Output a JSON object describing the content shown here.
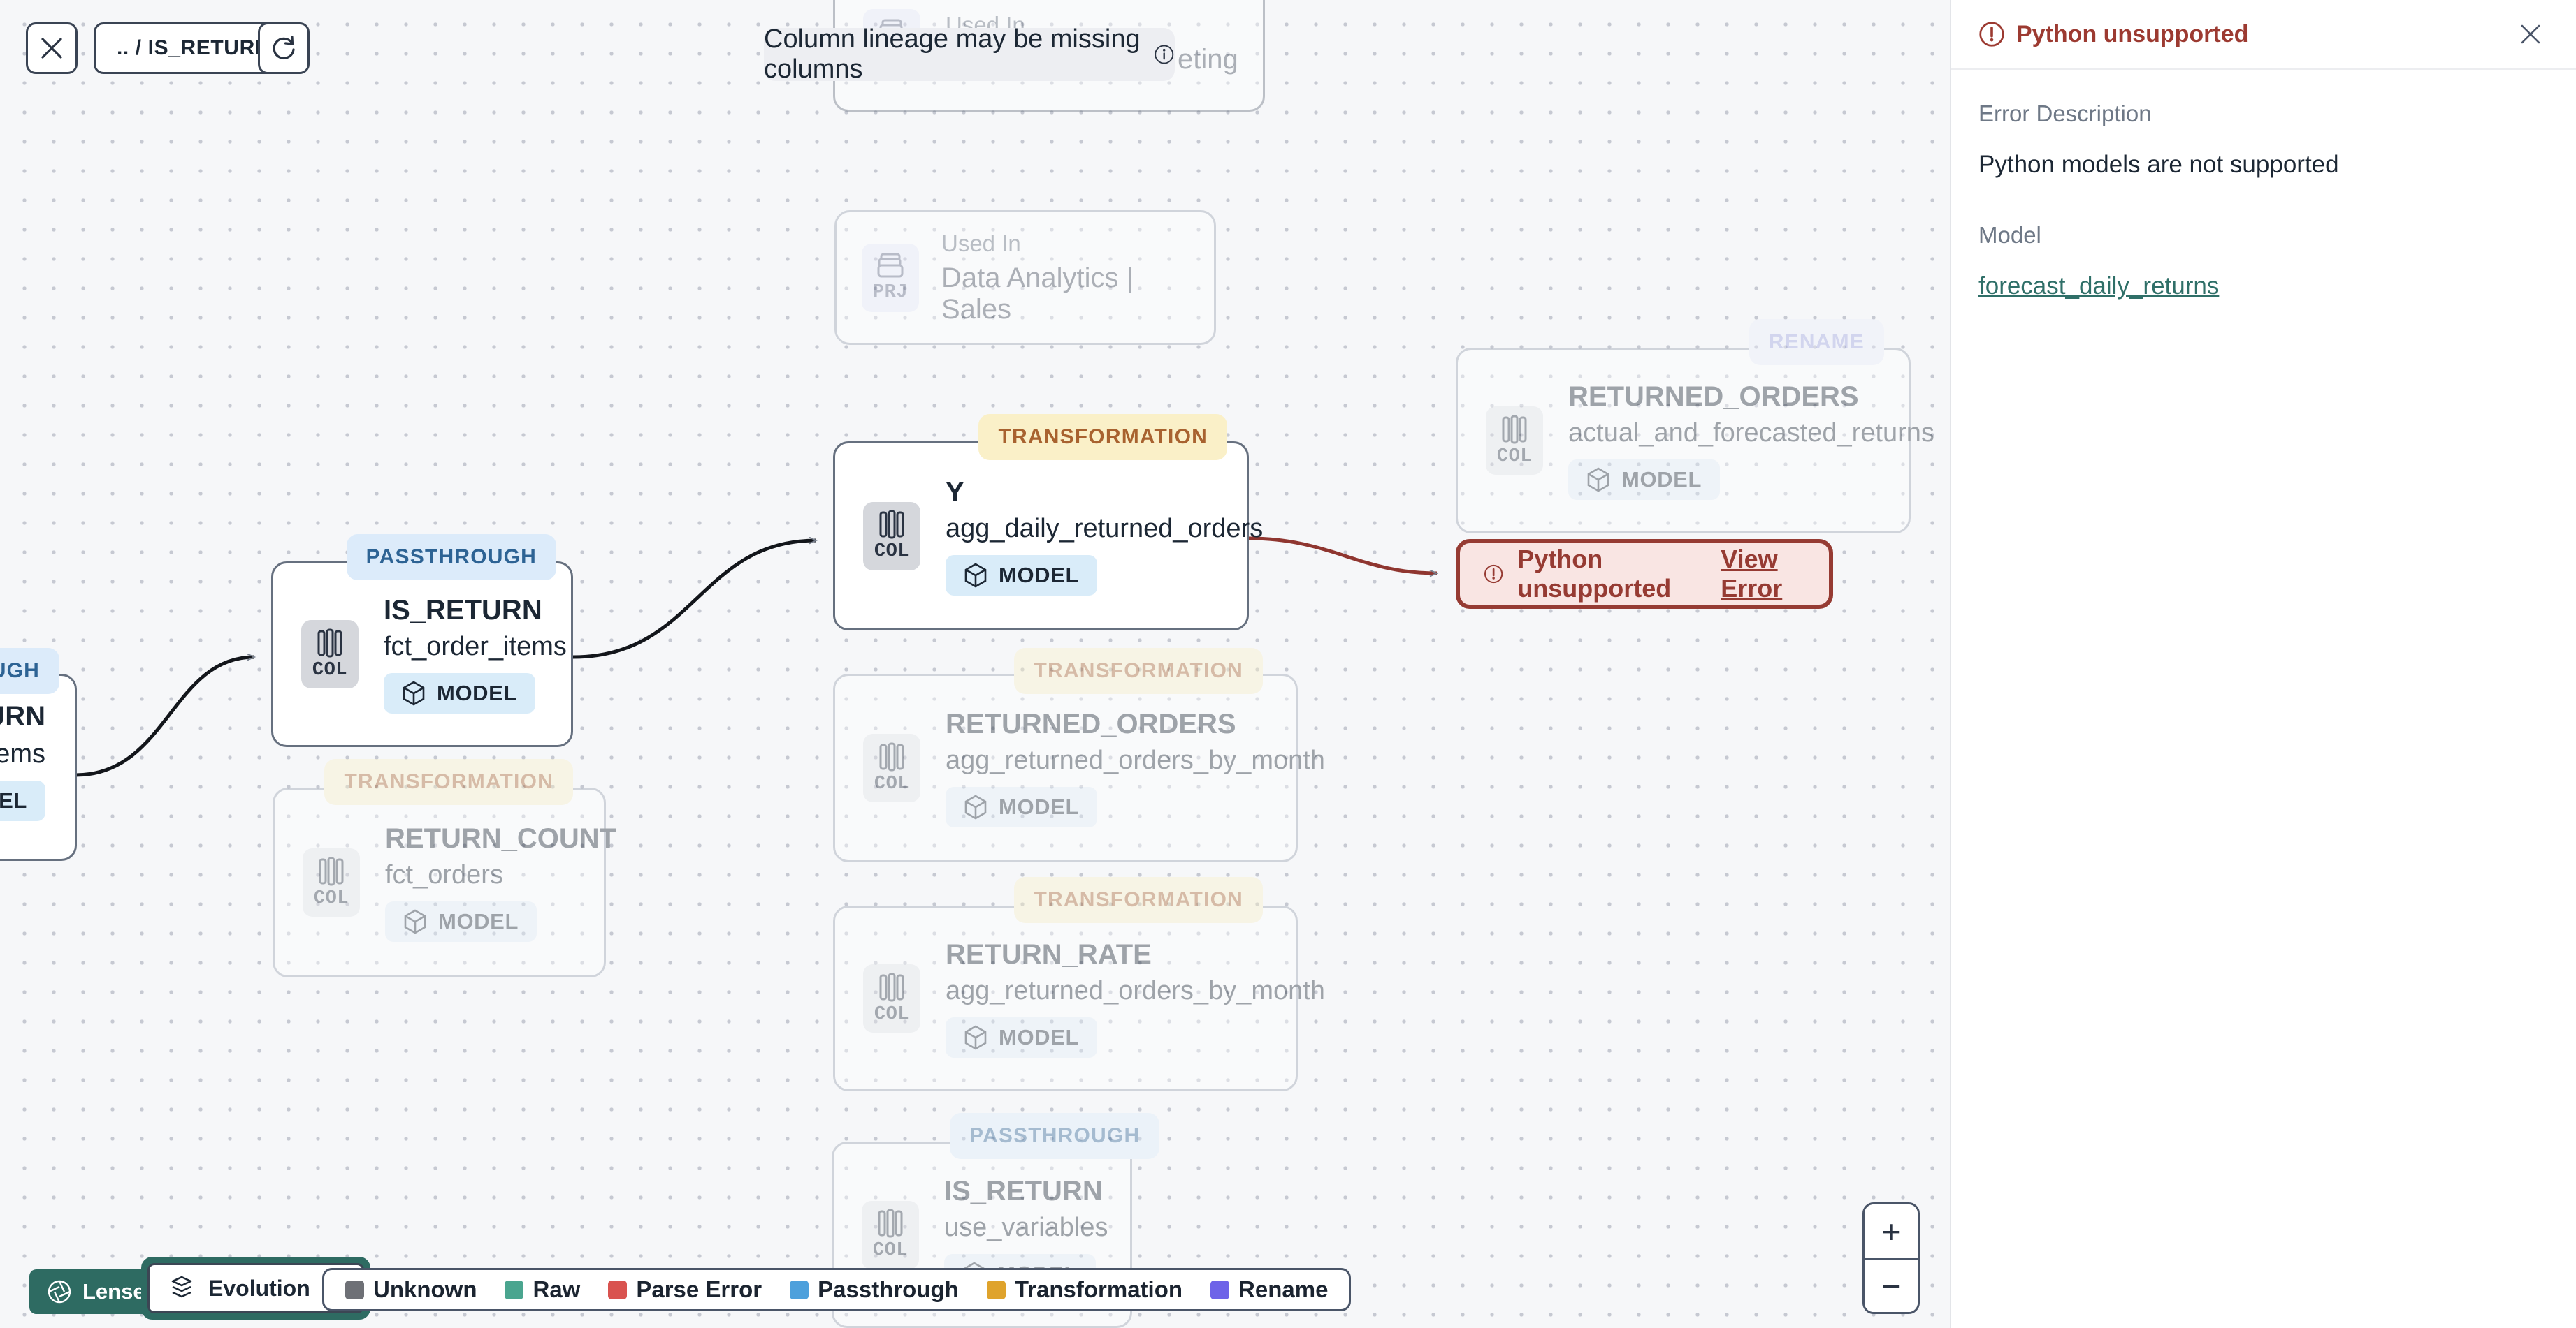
{
  "toolbar": {
    "breadcrumb": ".. / IS_RETURN"
  },
  "banner": {
    "text": "Column lineage may be missing columns"
  },
  "nodes": {
    "marketing_partial": {
      "title": "Used In",
      "subtitle_fragment": "eting",
      "icon": "PRJ"
    },
    "sales": {
      "title": "Used In",
      "subtitle": "Data Analytics | Sales",
      "icon": "PRJ"
    },
    "left_partial": {
      "badge_fragment": "OUGH",
      "title_fragment": "URN",
      "subtitle_fragment": "ems",
      "model_fragment": "DEL"
    },
    "fct_order_items": {
      "badge": "PASSTHROUGH",
      "title": "IS_RETURN",
      "subtitle": "fct_order_items",
      "icon": "COL",
      "model": "MODEL"
    },
    "agg_daily": {
      "badge": "TRANSFORMATION",
      "title": "Y",
      "subtitle": "agg_daily_returned_orders",
      "icon": "COL",
      "model": "MODEL"
    },
    "forecasted": {
      "badge": "RENAME",
      "title": "RETURNED_ORDERS",
      "subtitle": "actual_and_forecasted_returns",
      "icon": "COL",
      "model": "MODEL"
    },
    "return_count": {
      "badge": "TRANSFORMATION",
      "title": "RETURN_COUNT",
      "subtitle": "fct_orders",
      "icon": "COL",
      "model": "MODEL"
    },
    "monthly_orders": {
      "badge": "TRANSFORMATION",
      "title": "RETURNED_ORDERS",
      "subtitle": "agg_returned_orders_by_month",
      "icon": "COL",
      "model": "MODEL"
    },
    "return_rate": {
      "badge": "TRANSFORMATION",
      "title": "RETURN_RATE",
      "subtitle": "agg_returned_orders_by_month",
      "icon": "COL",
      "model": "MODEL"
    },
    "use_variables": {
      "badge": "PASSTHROUGH",
      "title": "IS_RETURN",
      "subtitle": "use_variables",
      "icon": "COL",
      "model": "MODEL"
    }
  },
  "error_node": {
    "text": "Python unsupported",
    "link": "View Error"
  },
  "error_panel": {
    "title": "Python unsupported",
    "description_label": "Error Description",
    "description": "Python models are not supported",
    "model_label": "Model",
    "model_link": "forecast_daily_returns"
  },
  "controls": {
    "lenses": "Lenses",
    "mode": "Evolution"
  },
  "legend": {
    "items": [
      {
        "label": "Unknown",
        "color": "#6E7076"
      },
      {
        "label": "Raw",
        "color": "#4AA58F"
      },
      {
        "label": "Parse Error",
        "color": "#D9534F"
      },
      {
        "label": "Passthrough",
        "color": "#4DA0DC"
      },
      {
        "label": "Transformation",
        "color": "#DFA32C"
      },
      {
        "label": "Rename",
        "color": "#6E63E8"
      }
    ]
  },
  "zoom": {
    "zoom_in": "+",
    "zoom_out": "−"
  },
  "colors": {
    "accent": "#2E6B62",
    "error": "#9C3A31",
    "error_bg": "#F9E5E3",
    "link": "#2F6F68"
  }
}
